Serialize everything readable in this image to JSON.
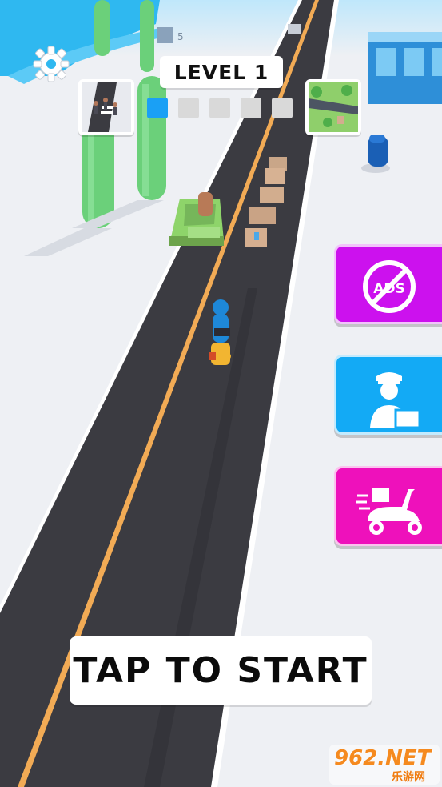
{
  "hud": {
    "level_label": "LEVEL 1",
    "level_progress": {
      "current": 1,
      "total": 5
    },
    "tap_to_start": "TAP TO START"
  },
  "side_buttons": {
    "no_ads_text": "ADS"
  },
  "scene_signs": {
    "pole_sign": "5"
  },
  "watermark": {
    "brand": "962.NET",
    "subtitle": "乐游网"
  },
  "colors": {
    "road": "#3b3b41",
    "road_line": "#f2ab55",
    "ground": "#eef0f4",
    "progress_active": "#1aa0f5",
    "progress_inactive": "#d9d9d9",
    "no_ads_button": "#cc11ee",
    "hire_button": "#13aaf5",
    "scooter_button": "#ee11bb",
    "cactus": "#6bd07a",
    "car": "#8ed46a",
    "watermark": "#f58a1f"
  },
  "icons": {
    "settings": "gear-icon",
    "no_ads": "no-ads-icon",
    "hire": "courier-icon",
    "scooter": "delivery-scooter-icon"
  }
}
